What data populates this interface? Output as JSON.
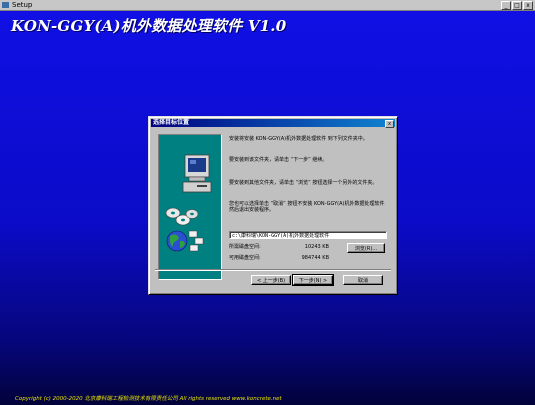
{
  "window": {
    "title": "Setup",
    "minimize": "_",
    "maximize": "□",
    "close": "x"
  },
  "app_title": "KON-GGY(A)机外数据处理软件 V1.0",
  "copyright": "Copyright (c) 2000-2020 北京康科瑞工程检测技术有限责任公司  All rights reserved  www.koncrete.net",
  "dialog": {
    "title": "选择目标位置",
    "close": "x",
    "para1": "安装将安装 KON-GGY(A)机外数据处理软件 到下列文件夹中。",
    "para2": "要安装到该文件夹，请单击 “下一步” 继续。",
    "para3": "要安装到其他文件夹，请单击 “浏览” 按钮选择一个另外的文件夹。",
    "para4": "您也可以选择单击 “取消” 按钮不安装 KON-GGY(A)机外数据处理软件 然后退出安装程序。",
    "path": "c:\\康科瑞\\KON-GGY(A)机外数据处理软件",
    "browse": "浏览(R)...",
    "required_label": "所需磁盘空间:",
    "required_value": "10243 KB",
    "available_label": "可用磁盘空间:",
    "available_value": "984744 KB",
    "back": "< 上一步(B)",
    "next": "下一步(N) >",
    "cancel": "取消"
  },
  "icons": {
    "window": "setup-window-icon",
    "computer": "computer-icon",
    "discs": "cd-disc-icon",
    "globe": "globe-icon"
  },
  "colors": {
    "background": "#1010e6",
    "art_panel": "#008080",
    "title_text": "#ffffff",
    "copyright_text": "#e8e400",
    "dialog_face": "#c0c0c0",
    "dialog_titlebar": "#000080"
  }
}
